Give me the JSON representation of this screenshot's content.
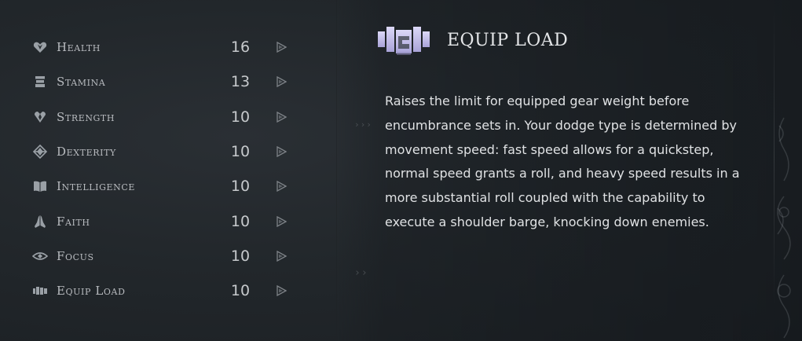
{
  "stats": [
    {
      "name": "Health",
      "value": "16",
      "icon": "heart-icon"
    },
    {
      "name": "Stamina",
      "value": "13",
      "icon": "stamina-icon"
    },
    {
      "name": "Strength",
      "value": "10",
      "icon": "strength-icon"
    },
    {
      "name": "Dexterity",
      "value": "10",
      "icon": "dexterity-icon"
    },
    {
      "name": "Intelligence",
      "value": "10",
      "icon": "book-icon"
    },
    {
      "name": "Faith",
      "value": "10",
      "icon": "praying-hands-icon"
    },
    {
      "name": "Focus",
      "value": "10",
      "icon": "eye-icon"
    },
    {
      "name": "Equip Load",
      "value": "10",
      "icon": "equip-load-icon"
    }
  ],
  "panel": {
    "title": "EQUIP LOAD",
    "icon": "equip-load-icon",
    "description": "Raises the limit for equipped gear weight before encumbrance sets in. Your dodge type is determined by movement speed: fast speed allows for a quickstep, normal speed grants a roll, and heavy speed results in a more substantial roll coupled with the capability to execute a shoulder barge, knocking down enemies."
  },
  "colors": {
    "text": "#b9bcc0",
    "title": "#e4e6e8",
    "accent_icon": "#c8c4ee"
  }
}
